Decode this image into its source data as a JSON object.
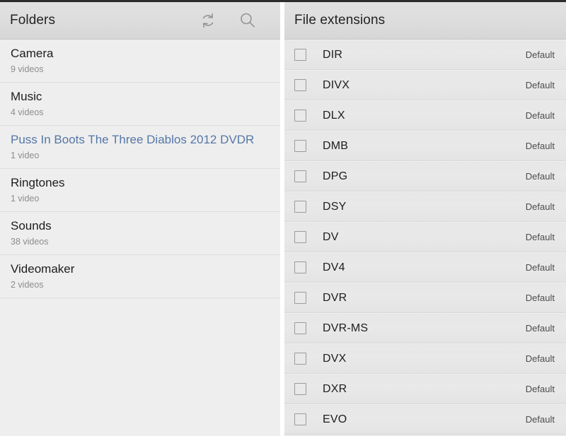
{
  "left_panel": {
    "header": {
      "title": "Folders",
      "actions": [
        {
          "name": "refresh-icon",
          "label": "Refresh"
        },
        {
          "name": "search-icon",
          "label": "Search"
        }
      ]
    },
    "folders": [
      {
        "name": "Camera",
        "count": "9 videos",
        "selected": false
      },
      {
        "name": "Music",
        "count": "4 videos",
        "selected": false
      },
      {
        "name": "Puss In Boots The Three Diablos 2012 DVDR",
        "count": "1 video",
        "selected": true
      },
      {
        "name": "Ringtones",
        "count": "1 video",
        "selected": false
      },
      {
        "name": "Sounds",
        "count": "38 videos",
        "selected": false
      },
      {
        "name": "Videomaker",
        "count": "2 videos",
        "selected": false
      }
    ]
  },
  "right_panel": {
    "header": {
      "title": "File extensions"
    },
    "extensions": [
      {
        "name": "DIR",
        "status": "Default",
        "checked": false
      },
      {
        "name": "DIVX",
        "status": "Default",
        "checked": false
      },
      {
        "name": "DLX",
        "status": "Default",
        "checked": false
      },
      {
        "name": "DMB",
        "status": "Default",
        "checked": false
      },
      {
        "name": "DPG",
        "status": "Default",
        "checked": false
      },
      {
        "name": "DSY",
        "status": "Default",
        "checked": false
      },
      {
        "name": "DV",
        "status": "Default",
        "checked": false
      },
      {
        "name": "DV4",
        "status": "Default",
        "checked": false
      },
      {
        "name": "DVR",
        "status": "Default",
        "checked": false
      },
      {
        "name": "DVR-MS",
        "status": "Default",
        "checked": false
      },
      {
        "name": "DVX",
        "status": "Default",
        "checked": false
      },
      {
        "name": "DXR",
        "status": "Default",
        "checked": false
      },
      {
        "name": "EVO",
        "status": "Default",
        "checked": false
      }
    ]
  },
  "colors": {
    "panel_bg_left": "#eeeeee",
    "panel_bg_right": "#e9e9e9",
    "header_bg": "#dcdcdc",
    "selected_text": "#5577a8",
    "primary_text": "#1d1d1d",
    "secondary_text": "#8d8d8d",
    "divider": "#dddddd",
    "top_strip": "#2c2c2c"
  }
}
